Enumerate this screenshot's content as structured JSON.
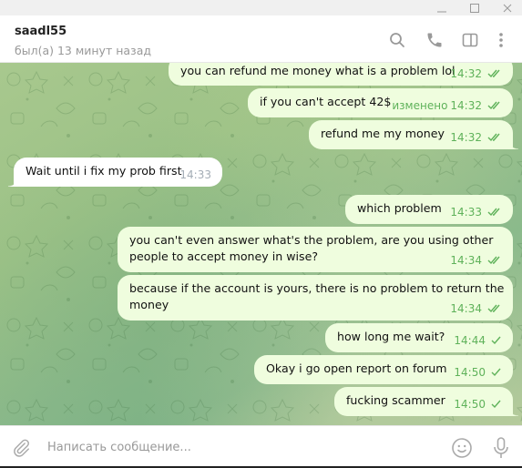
{
  "window": {
    "controls": [
      "minimize",
      "maximize",
      "close"
    ]
  },
  "header": {
    "peer_name": "saadl55",
    "peer_status": "был(а) 13 минут назад",
    "icons": [
      "search-icon",
      "phone-icon",
      "sidebar-toggle-icon",
      "more-vertical-icon"
    ]
  },
  "colors": {
    "outgoing_bubble": "#effdde",
    "incoming_bubble": "#ffffff",
    "outgoing_meta": "#5fb25a",
    "incoming_meta": "#a4adb6"
  },
  "messages": [
    {
      "direction": "out",
      "text": "you can refund me money what is a problem lol",
      "time": "14:32",
      "edited": "",
      "status": "read"
    },
    {
      "direction": "out",
      "text": "if you can't accept 42$",
      "time": "14:32",
      "edited": "изменено",
      "status": "read"
    },
    {
      "direction": "out",
      "text": "refund me my money",
      "time": "14:32",
      "edited": "",
      "status": "read"
    },
    {
      "direction": "in",
      "text": "Wait until i fix my prob first",
      "time": "14:33",
      "edited": "",
      "status": ""
    },
    {
      "direction": "out",
      "text": "which problem",
      "time": "14:33",
      "edited": "",
      "status": "read"
    },
    {
      "direction": "out",
      "text": "you can't even answer what's the problem, are you using other\npeople to accept money in wise?",
      "time": "14:34",
      "edited": "",
      "status": "read"
    },
    {
      "direction": "out",
      "text": "because if the account is yours, there is no problem to return the\nmoney",
      "time": "14:34",
      "edited": "",
      "status": "read"
    },
    {
      "direction": "out",
      "text": "how long me wait?",
      "time": "14:44",
      "edited": "",
      "status": "sent"
    },
    {
      "direction": "out",
      "text": "Okay i go open report on forum",
      "time": "14:50",
      "edited": "",
      "status": "sent"
    },
    {
      "direction": "out",
      "text": "fucking scammer",
      "time": "14:50",
      "edited": "",
      "status": "sent"
    }
  ],
  "composer": {
    "placeholder": "Написать сообщение...",
    "value": ""
  }
}
